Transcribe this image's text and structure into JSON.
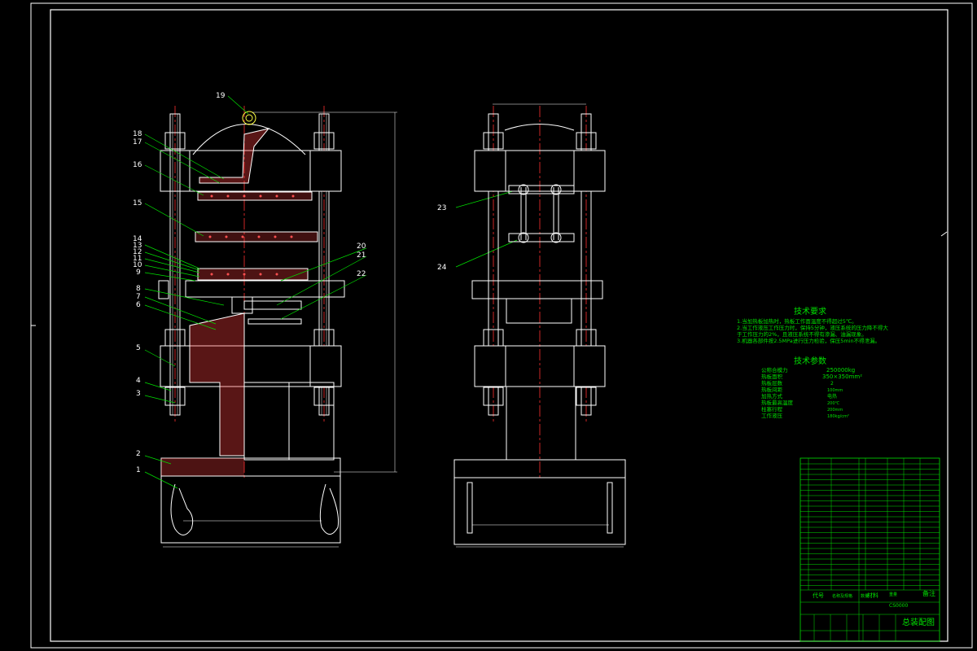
{
  "drawing": {
    "title_block_name": "总装配图",
    "tech_requirements": {
      "heading": "技术要求",
      "lines": [
        "1.当加热板加热时，热板工作面温度不得超过5℃。",
        "2.当工作液压工作压力时，保持5分钟，液压系统的压力降不得大",
        "  于工作压力的2%，且液压系统不得有渗漏、油漏现象。",
        "3.机器各部件按2.5MPa进行压力检验，保压5min不得泄漏。"
      ]
    },
    "tech_params": {
      "heading": "技术参数",
      "rows": [
        {
          "name": "公称合模力",
          "value": "250000kg"
        },
        {
          "name": "热板面积",
          "value": "350×350mm²"
        },
        {
          "name": "热板层数",
          "value": "2"
        },
        {
          "name": "热板间距",
          "value": "100mm"
        },
        {
          "name": "加热方式",
          "value": "电热"
        },
        {
          "name": "热板最高温度",
          "value": "200℃"
        },
        {
          "name": "柱塞行程",
          "value": "200mm"
        },
        {
          "name": "工作液压",
          "value": "180kg/cm²"
        }
      ]
    },
    "part_labels": [
      "1",
      "2",
      "3",
      "4",
      "5",
      "6",
      "7",
      "8",
      "9",
      "10",
      "11",
      "12",
      "13",
      "14",
      "15",
      "16",
      "17",
      "18",
      "19",
      "20",
      "21",
      "22",
      "23",
      "24"
    ],
    "title_block": {
      "drawing_no": "CS0000",
      "head_code": "代号",
      "head_name": "名称及规格",
      "head_qty": "数量",
      "head_material": "材料",
      "head_weight": "重量",
      "head_note": "备注",
      "remark": "备注"
    }
  }
}
